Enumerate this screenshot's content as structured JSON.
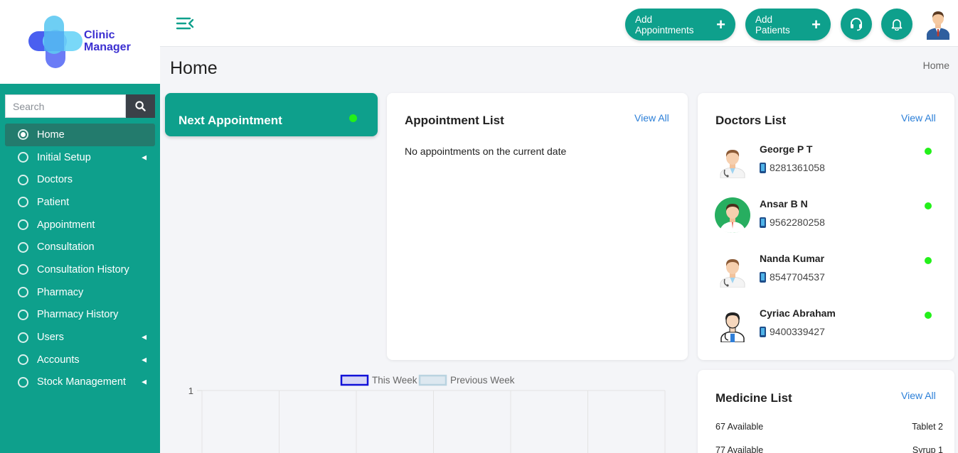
{
  "app": {
    "logo_line1": "Clinic",
    "logo_line2": "Manager"
  },
  "search": {
    "placeholder": "Search"
  },
  "sidebar": {
    "items": [
      {
        "label": "Home",
        "active": true,
        "has_submenu": false
      },
      {
        "label": "Initial Setup",
        "active": false,
        "has_submenu": true
      },
      {
        "label": "Doctors",
        "active": false,
        "has_submenu": false
      },
      {
        "label": "Patient",
        "active": false,
        "has_submenu": false
      },
      {
        "label": "Appointment",
        "active": false,
        "has_submenu": false
      },
      {
        "label": "Consultation",
        "active": false,
        "has_submenu": false
      },
      {
        "label": "Consultation History",
        "active": false,
        "has_submenu": false
      },
      {
        "label": "Pharmacy",
        "active": false,
        "has_submenu": false
      },
      {
        "label": "Pharmacy History",
        "active": false,
        "has_submenu": false
      },
      {
        "label": "Users",
        "active": false,
        "has_submenu": true
      },
      {
        "label": "Accounts",
        "active": false,
        "has_submenu": true
      },
      {
        "label": "Stock Management",
        "active": false,
        "has_submenu": true
      }
    ]
  },
  "header": {
    "add_appointments_label": "Add Appointments",
    "add_patients_label": "Add Patients"
  },
  "page": {
    "title": "Home",
    "breadcrumb": "Home"
  },
  "next_appointment": {
    "title": "Next Appointment"
  },
  "appointment_list": {
    "title": "Appointment List",
    "view_all": "View All",
    "empty_message": "No appointments on the current date"
  },
  "doctors_list": {
    "title": "Doctors List",
    "view_all": "View All",
    "doctors": [
      {
        "name": "George P T",
        "phone": "8281361058",
        "avatar": "doctor-avatar-1"
      },
      {
        "name": "Ansar B N",
        "phone": "9562280258",
        "avatar": "doctor-avatar-2"
      },
      {
        "name": "Nanda Kumar",
        "phone": "8547704537",
        "avatar": "doctor-avatar-1"
      },
      {
        "name": "Cyriac Abraham",
        "phone": "9400339427",
        "avatar": "doctor-avatar-3"
      }
    ]
  },
  "medicine_list": {
    "title": "Medicine List",
    "view_all": "View All",
    "items": [
      {
        "availability": "67 Available",
        "name": "Tablet 2"
      },
      {
        "availability": "77 Available",
        "name": "Syrup 1"
      }
    ]
  },
  "colors": {
    "primary": "#0ea08c",
    "active_nav": "#237b6d",
    "online": "#23f01a",
    "link": "#2b7fd8"
  },
  "chart_data": {
    "type": "bar",
    "categories": [
      "",
      "",
      "",
      "",
      "",
      ""
    ],
    "series": [
      {
        "name": "This Week",
        "values": []
      },
      {
        "name": "Previous Week",
        "values": []
      }
    ],
    "yticks": [
      "1"
    ],
    "legend": "top-center",
    "grid": true
  }
}
